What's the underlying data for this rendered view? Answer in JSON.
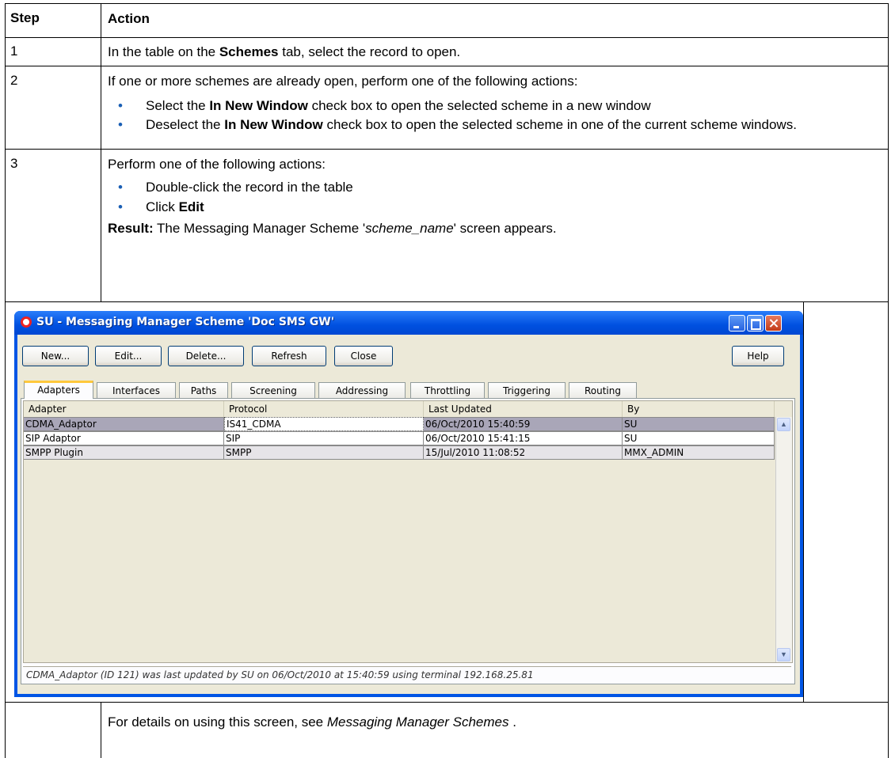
{
  "table": {
    "header": {
      "step": "Step",
      "action": "Action"
    },
    "row1": {
      "step": "1",
      "pre": "In the table on the ",
      "bold": "Schemes",
      "post": " tab, select the record to open."
    },
    "row2": {
      "step": "2",
      "intro": "If one or more schemes are already open, perform one of the following actions:",
      "b1_pre": "Select the ",
      "b1_bold": "In New Window",
      "b1_post": " check box to open the selected scheme in a new window",
      "b2_pre": "Deselect the ",
      "b2_bold": "In New Window",
      "b2_post": " check box to open the selected scheme in one of the current scheme windows."
    },
    "row3": {
      "step": "3",
      "intro": "Perform one of the following actions:",
      "b1": "Double-click the record in the table",
      "b2_pre": "Click ",
      "b2_bold": "Edit",
      "result_label": "Result:",
      "result_pre": " The Messaging Manager Scheme '",
      "result_italic": "scheme_name",
      "result_post": "' screen appears."
    },
    "footer": {
      "pre": "For details on using this screen, see ",
      "italic": "Messaging Manager Schemes",
      "post": " ."
    }
  },
  "window": {
    "title": "SU - Messaging Manager Scheme 'Doc SMS GW'",
    "buttons": [
      "New...",
      "Edit...",
      "Delete...",
      "Refresh",
      "Close"
    ],
    "help": "Help",
    "tabs": [
      "Adapters",
      "Interfaces",
      "Paths",
      "Screening",
      "Addressing",
      "Throttling",
      "Triggering",
      "Routing"
    ],
    "columns": [
      "Adapter",
      "Protocol",
      "Last Updated",
      "By"
    ],
    "rows": [
      [
        "CDMA_Adaptor",
        "IS41_CDMA",
        "06/Oct/2010 15:40:59",
        "SU"
      ],
      [
        "SIP Adaptor",
        "SIP",
        "06/Oct/2010 15:41:15",
        "SU"
      ],
      [
        "SMPP Plugin",
        "SMPP",
        "15/Jul/2010 11:08:52",
        "MMX_ADMIN"
      ]
    ],
    "status": "CDMA_Adaptor (ID 121) was last updated by SU on 06/Oct/2010 at 15:40:59 using terminal 192.168.25.81",
    "bullet": "•"
  }
}
